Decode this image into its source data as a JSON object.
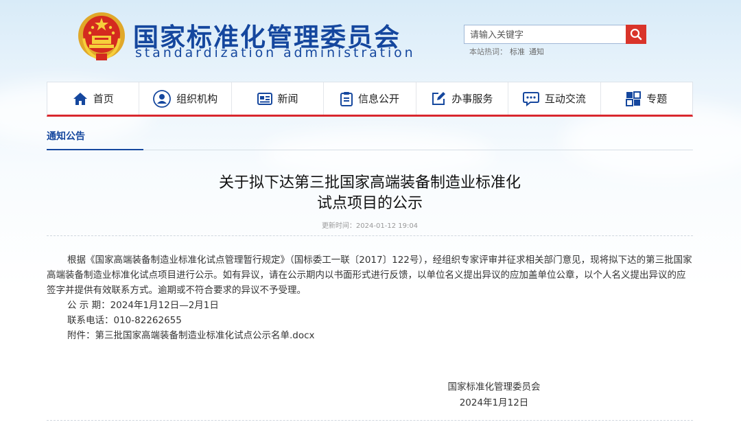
{
  "header": {
    "title": "国家标准化管理委员会",
    "subtitle": "standardization administration",
    "search_placeholder": "请输入关键字",
    "hot_label": "本站热词：",
    "hot_words": [
      "标准",
      "通知"
    ]
  },
  "nav": {
    "items": [
      {
        "label": "首页",
        "icon": "home-icon"
      },
      {
        "label": "组织机构",
        "icon": "user-icon"
      },
      {
        "label": "新闻",
        "icon": "news-icon"
      },
      {
        "label": "信息公开",
        "icon": "clipboard-icon"
      },
      {
        "label": "办事服务",
        "icon": "edit-icon"
      },
      {
        "label": "互动交流",
        "icon": "chat-icon"
      },
      {
        "label": "专题",
        "icon": "topic-icon"
      }
    ]
  },
  "breadcrumb": {
    "label": "通知公告"
  },
  "article": {
    "title_line1": "关于拟下达第三批国家高端装备制造业标准化",
    "title_line2": "试点项目的公示",
    "update_time": "更新时间：2024-01-12 19:04",
    "paragraph": "根据《国家高端装备制造业标准化试点管理暂行规定》（国标委工一联〔2017〕122号），经组织专家评审并征求相关部门意见，现将拟下达的第三批国家高端装备制造业标准化试点项目进行公示。如有异议，请在公示期内以书面形式进行反馈，以单位名义提出异议的应加盖单位公章，以个人名义提出异议的应签字并提供有效联系方式。逾期或不符合要求的异议不予受理。",
    "period": "公 示 期：2024年1月12日—2月1日",
    "phone": "联系电话：010-82262655",
    "attachment_label": "附件：",
    "attachment_link": "第三批国家高端装备制造业标准化试点公示名单.docx",
    "signature_org": "国家标准化管理委员会",
    "signature_date": "2024年1月12日"
  },
  "colors": {
    "brand_blue": "#15479e",
    "accent_red": "#d9272e"
  }
}
